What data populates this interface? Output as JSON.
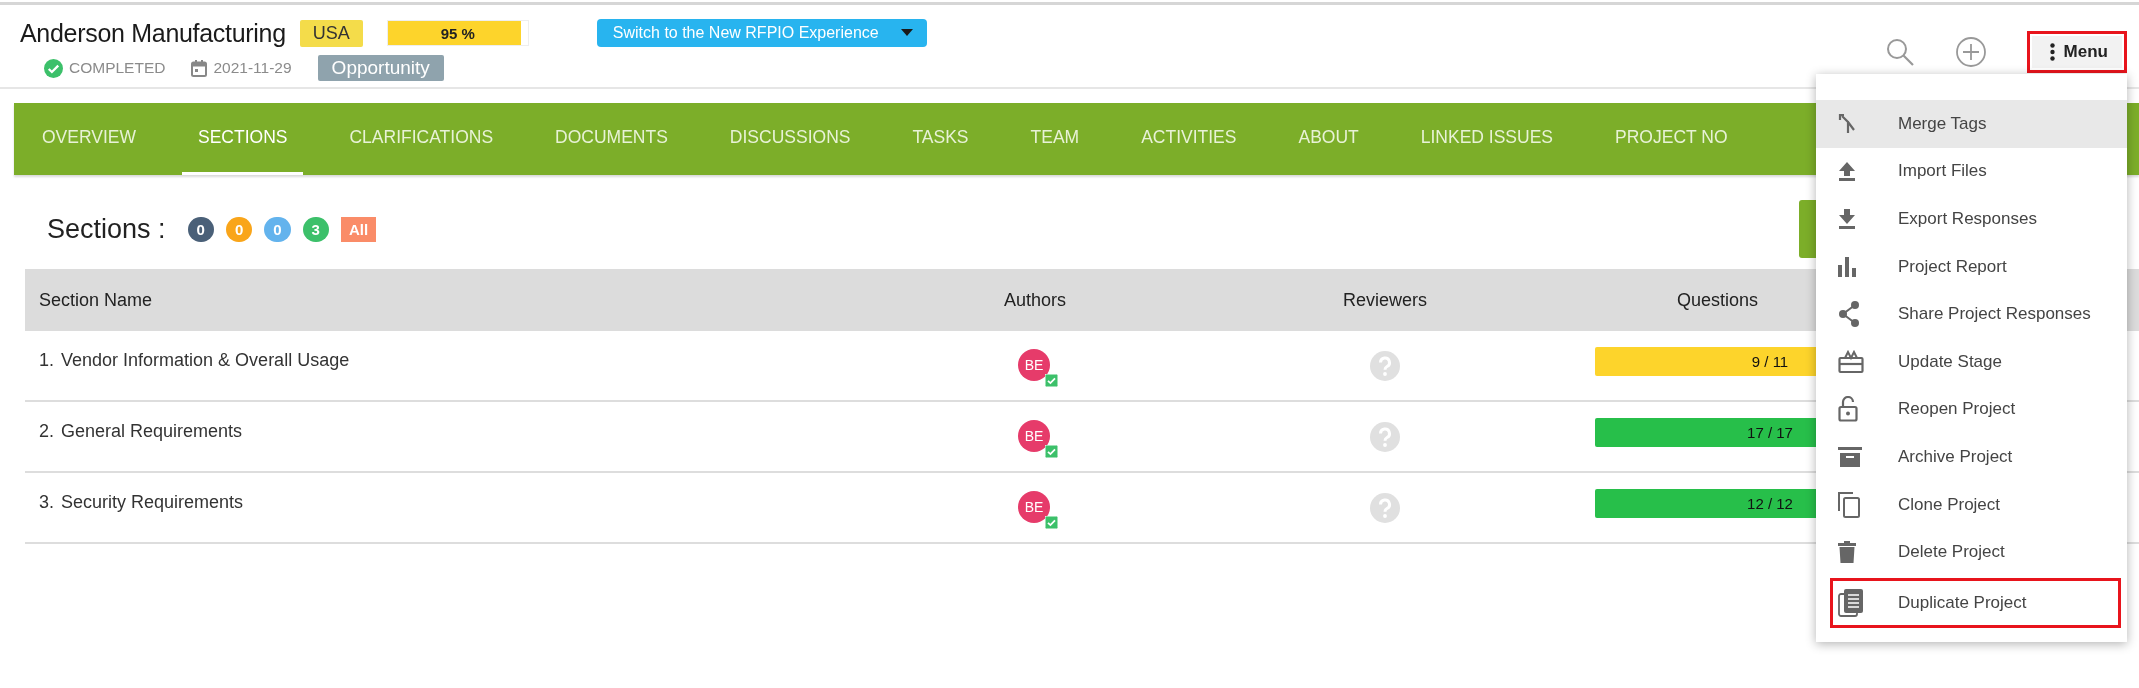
{
  "project": {
    "title": "Anderson Manufacturing",
    "region": "USA",
    "progress": {
      "reading": "95 %",
      "level": 0.95
    },
    "switch_button": "Switch to the New RFPIO Experience",
    "status": "COMPLETED",
    "due_date": "2021-11-29",
    "stage": "Opportunity"
  },
  "toolbar": {
    "menu_button": {
      "label": "Menu",
      "outlined": true
    }
  },
  "tabs": [
    {
      "label": "OVERVIEW",
      "selected": false
    },
    {
      "label": "SECTIONS",
      "selected": true
    },
    {
      "label": "CLARIFICATIONS",
      "selected": false
    },
    {
      "label": "DOCUMENTS",
      "selected": false
    },
    {
      "label": "DISCUSSIONS",
      "selected": false
    },
    {
      "label": "TASKS",
      "selected": false
    },
    {
      "label": "TEAM",
      "selected": false
    },
    {
      "label": "ACTIVITIES",
      "selected": false
    },
    {
      "label": "ABOUT",
      "selected": false
    },
    {
      "label": "LINKED ISSUES",
      "selected": false
    },
    {
      "label": "PROJECT NO",
      "selected": false
    }
  ],
  "sections_summary": {
    "label": "Sections :",
    "counts": [
      {
        "count": "0",
        "color": "#4a6078"
      },
      {
        "count": "0",
        "color": "#f9a51a"
      },
      {
        "count": "0",
        "color": "#63b3ed"
      },
      {
        "count": "3",
        "color": "#3cc06a"
      }
    ],
    "all_filter": "All"
  },
  "table": {
    "columns": [
      "Section Name",
      "Authors",
      "Reviewers",
      "Questions"
    ],
    "rows": [
      {
        "number": "1.",
        "name": "Vendor Information & Overall Usage",
        "author": "BE",
        "questions": "9 / 11",
        "color": "#fdd42b"
      },
      {
        "number": "2.",
        "name": "General Requirements",
        "author": "BE",
        "questions": "17 / 17",
        "color": "#27bf4a"
      },
      {
        "number": "3.",
        "name": "Security Requirements",
        "author": "BE",
        "questions": "12 / 12",
        "color": "#27bf4a"
      }
    ]
  },
  "menu": {
    "items": [
      {
        "kind": "merge",
        "label": "Merge Tags",
        "highlighted": true,
        "outlined": false
      },
      {
        "kind": "import",
        "label": "Import Files",
        "highlighted": false,
        "outlined": false
      },
      {
        "kind": "export",
        "label": "Export Responses",
        "highlighted": false,
        "outlined": false
      },
      {
        "kind": "report",
        "label": "Project Report",
        "highlighted": false,
        "outlined": false
      },
      {
        "kind": "share",
        "label": "Share Project Responses",
        "highlighted": false,
        "outlined": false
      },
      {
        "kind": "stage",
        "label": "Update Stage",
        "highlighted": false,
        "outlined": false
      },
      {
        "kind": "reopen",
        "label": "Reopen Project",
        "highlighted": false,
        "outlined": false
      },
      {
        "kind": "archive",
        "label": "Archive Project",
        "highlighted": false,
        "outlined": false
      },
      {
        "kind": "clone",
        "label": "Clone Project",
        "highlighted": false,
        "outlined": false
      },
      {
        "kind": "delete",
        "label": "Delete Project",
        "highlighted": false,
        "outlined": false
      },
      {
        "kind": "duplicate",
        "label": "Duplicate Project",
        "highlighted": false,
        "outlined": true
      }
    ]
  }
}
